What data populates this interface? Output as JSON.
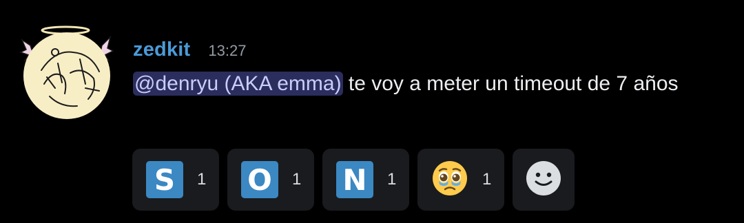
{
  "message": {
    "username": "zedkit",
    "timestamp": "13:27",
    "mention": "@denryu (AKA emma)",
    "text": " te voy a meter un timeout de 7 años"
  },
  "colors": {
    "username": "#4b9ad8",
    "mention_bg": "#2b2d5c",
    "mention_text": "#c9cdfb",
    "reaction_bg": "#1a1b1e",
    "letter_tile": "#3b88c3"
  },
  "reactions": [
    {
      "type": "regional-indicator",
      "letter": "S",
      "count": "1"
    },
    {
      "type": "regional-indicator",
      "letter": "O",
      "count": "1"
    },
    {
      "type": "regional-indicator",
      "letter": "N",
      "count": "1"
    },
    {
      "type": "emoji",
      "icon": "pleading-face-icon",
      "count": "1"
    }
  ],
  "add_reaction": {
    "icon": "add-reaction-smiley-icon"
  }
}
